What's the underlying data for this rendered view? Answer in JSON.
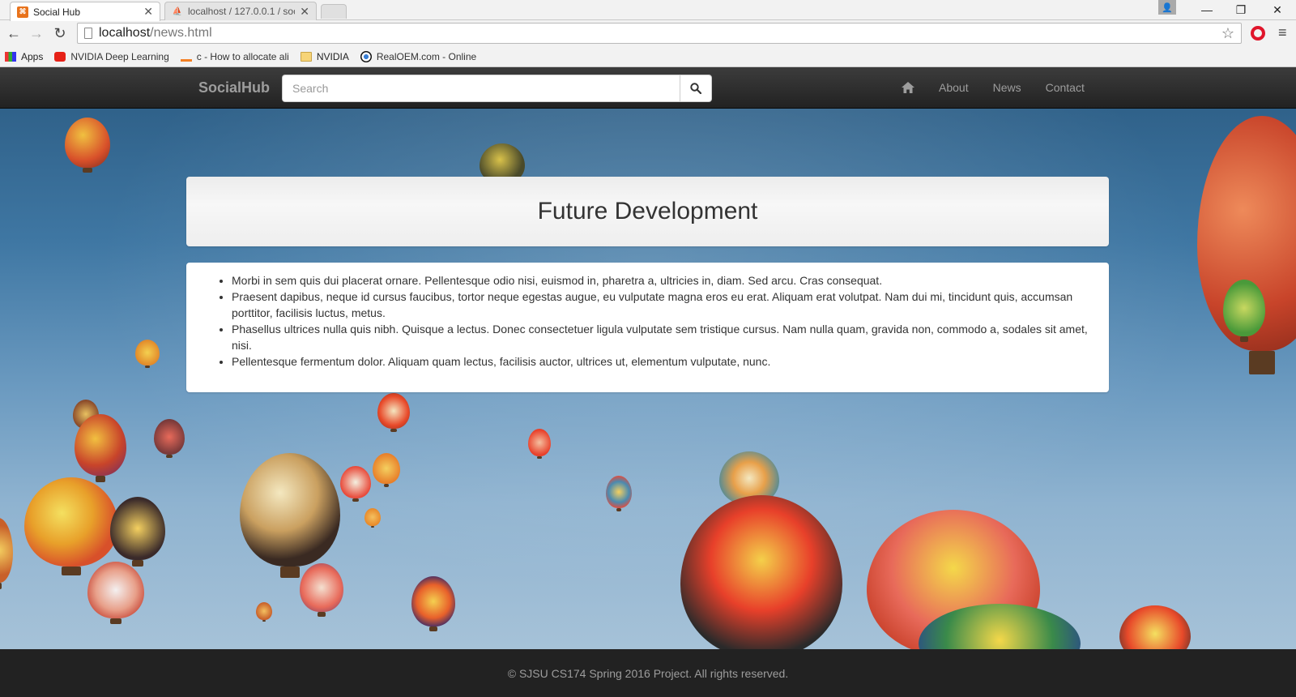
{
  "browser": {
    "tabs": [
      {
        "title": "Social Hub",
        "favicon": "socialhub-favicon",
        "active": true
      },
      {
        "title": "localhost / 127.0.0.1 / soc",
        "favicon": "phpmyadmin-favicon",
        "active": false
      }
    ],
    "url": {
      "host": "localhost",
      "path": "/news.html"
    },
    "bookmarks": [
      {
        "label": "Apps",
        "icon": "apps-icon"
      },
      {
        "label": "NVIDIA Deep Learning",
        "icon": "youtube-icon"
      },
      {
        "label": "c - How to allocate ali",
        "icon": "stackoverflow-icon"
      },
      {
        "label": "NVIDIA",
        "icon": "folder-icon"
      },
      {
        "label": "RealOEM.com - Online",
        "icon": "bmw-icon"
      }
    ],
    "window_controls": {
      "minimize": "—",
      "restore": "❐",
      "close": "✕"
    }
  },
  "navbar": {
    "brand": "SocialHub",
    "search_placeholder": "Search",
    "links": [
      "About",
      "News",
      "Contact"
    ],
    "home_icon": "home-icon",
    "search_icon": "search-icon"
  },
  "main": {
    "heading": "Future Development",
    "items": [
      "Morbi in sem quis dui placerat ornare. Pellentesque odio nisi, euismod in, pharetra a, ultricies in, diam. Sed arcu. Cras consequat.",
      "Praesent dapibus, neque id cursus faucibus, tortor neque egestas augue, eu vulputate magna eros eu erat. Aliquam erat volutpat. Nam dui mi, tincidunt quis, accumsan porttitor, facilisis luctus, metus.",
      "Phasellus ultrices nulla quis nibh. Quisque a lectus. Donec consectetuer ligula vulputate sem tristique cursus. Nam nulla quam, gravida non, commodo a, sodales sit amet, nisi.",
      "Pellentesque fermentum dolor. Aliquam quam lectus, facilisis auctor, ultrices ut, elementum vulputate, nunc."
    ]
  },
  "footer": {
    "text": "© SJSU CS174 Spring 2016 Project. All rights reserved."
  }
}
